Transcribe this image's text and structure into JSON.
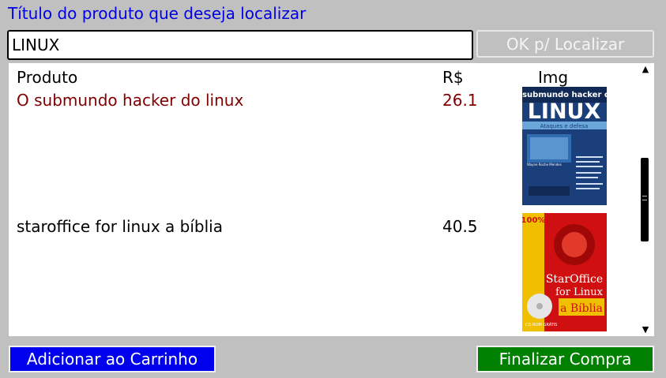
{
  "header": {
    "title": "Título do produto que deseja localizar"
  },
  "search": {
    "value": "LINUX",
    "button_label": "OK p/ Localizar"
  },
  "list": {
    "columns": {
      "product": "Produto",
      "price": "R$",
      "image": "Img"
    },
    "items": [
      {
        "name": "O submundo hacker do linux",
        "price": "26.1",
        "selected": true,
        "cover": {
          "title_top": "O submundo hacker do",
          "title_big": "LINUX",
          "band": "Ataques e defesa",
          "author": "Wayne Roche Mendes",
          "colors": {
            "bg": "#1a3f7a",
            "band": "#6aa7d8"
          }
        }
      },
      {
        "name": "staroffice for linux a bíblia",
        "price": "40.5",
        "selected": false,
        "cover": {
          "badge": "100%",
          "title_line1": "StarOffice",
          "title_line2": "for Linux",
          "title_line3": "a Bíblia",
          "cd_label": "CD-ROM GRÁTIS",
          "colors": {
            "bg": "#d01010",
            "badge": "#f0c000"
          }
        }
      }
    ]
  },
  "footer": {
    "add_label": "Adicionar ao Carrinho",
    "finish_label": "Finalizar Compra"
  },
  "colors": {
    "background": "#c0c0c0",
    "title": "#0000e6",
    "selected_row": "#800000",
    "add_button": "#0000ee",
    "finish_button": "#008000"
  }
}
